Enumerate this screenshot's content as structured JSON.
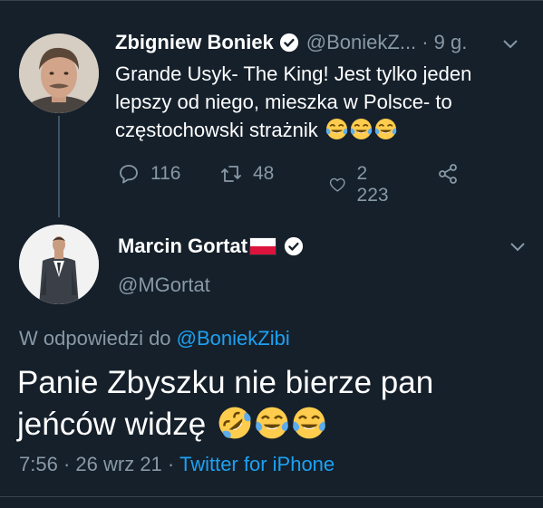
{
  "tweet1": {
    "name": "Zbigniew Boniek",
    "handle": "@BoniekZ...",
    "time": "· 9 g.",
    "lines": [
      "Grande Usyk- The King! Jest tylko jeden",
      "lepszy od niego, mieszka w Polsce-  to",
      "częstochowski strażnik"
    ],
    "emojis": [
      "face-with-tears-of-joy",
      "face-with-tears-of-joy",
      "face-with-tears-of-joy"
    ],
    "actions": {
      "reply_count": "116",
      "retweet_count": "48",
      "like_count": "2 223"
    }
  },
  "tweet2": {
    "name": "Marcin Gortat",
    "flag": "poland-flag",
    "handle": "@MGortat",
    "replying_prefix": "W odpowiedzi do",
    "replying_handle": "@BoniekZibi",
    "text_line1": "Panie Zbyszku nie bierze pan",
    "text_line2": "jeńców widzę",
    "emojis": [
      "rolling-on-the-floor-laughing",
      "face-with-tears-of-joy",
      "face-with-tears-of-joy"
    ],
    "time": "7:56",
    "sep1": "·",
    "date": "26 wrz 21",
    "sep2": "·",
    "source": "Twitter for iPhone"
  },
  "colors": {
    "background": "#15202b",
    "secondary_text": "#8899a6",
    "link": "#1da1f2",
    "divider": "#38444d"
  },
  "icons": [
    "verified-icon",
    "chevron-down-icon",
    "reply-icon",
    "retweet-icon",
    "like-icon",
    "share-icon"
  ]
}
